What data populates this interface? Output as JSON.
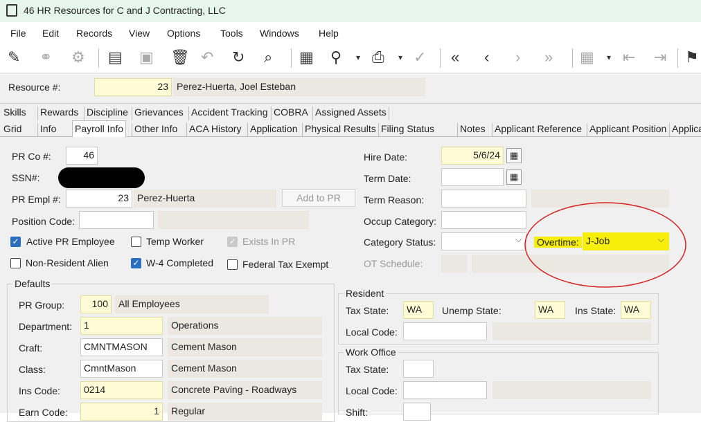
{
  "window": {
    "title": "46 HR Resources for C and J Contracting, LLC"
  },
  "menu": [
    "File",
    "Edit",
    "Records",
    "View",
    "Options",
    "Tools",
    "Windows",
    "Help"
  ],
  "header": {
    "resource_label": "Resource #:",
    "resource_num": "23",
    "resource_name": "Perez-Huerta, Joel Esteban"
  },
  "tabs_row1": [
    "Skills",
    "Rewards",
    "Discipline",
    "Grievances",
    "Accident Tracking",
    "COBRA",
    "Assigned Assets"
  ],
  "tabs_row2": [
    "Grid",
    "Info",
    "Payroll Info",
    "Other Info",
    "ACA History",
    "Application",
    "Physical Results",
    "Filing Status",
    "Notes",
    "Applicant Reference",
    "Applicant Position",
    "Applica"
  ],
  "form": {
    "prco_label": "PR Co #:",
    "prco": "46",
    "ssn_label": "SSN#:",
    "prempl_label": "PR Empl #:",
    "prempl": "23",
    "prempl_name": "Perez-Huerta",
    "addpr": "Add to PR",
    "poscode_label": "Position Code:",
    "active_pr": "Active PR Employee",
    "temp_worker": "Temp Worker",
    "exists_pr": "Exists In PR",
    "nonres": "Non-Resident Alien",
    "w4": "W-4 Completed",
    "fedexempt": "Federal Tax Exempt",
    "hire_label": "Hire Date:",
    "hire": "5/6/24",
    "term_label": "Term Date:",
    "termreason_label": "Term Reason:",
    "occup_label": "Occup Category:",
    "catstatus_label": "Category Status:",
    "overtime_label": "Overtime:",
    "overtime": "J-Job",
    "otsched_label": "OT Schedule:"
  },
  "defaults": {
    "title": "Defaults",
    "prgroup_label": "PR Group:",
    "prgroup": "100",
    "prgroup_name": "All Employees",
    "dept_label": "Department:",
    "dept": "1",
    "dept_name": "Operations",
    "craft_label": "Craft:",
    "craft": "CMNTMASON",
    "craft_name": "Cement Mason",
    "class_label": "Class:",
    "class": "CmntMason",
    "class_name": "Cement Mason",
    "ins_label": "Ins Code:",
    "ins": "0214",
    "ins_name": "Concrete Paving - Roadways",
    "earn_label": "Earn Code:",
    "earn": "1",
    "earn_name": "Regular"
  },
  "resident": {
    "title": "Resident",
    "taxstate_label": "Tax State:",
    "taxstate": "WA",
    "unemp_label": "Unemp State:",
    "unemp": "WA",
    "insstate_label": "Ins State:",
    "insstate": "WA",
    "local_label": "Local Code:"
  },
  "workoffice": {
    "title": "Work Office",
    "taxstate_label": "Tax State:",
    "local_label": "Local Code:",
    "shift_label": "Shift:"
  },
  "colors": {
    "highlight": "#f7ee0a",
    "annotation": "#d42020",
    "required": "#fffbd4"
  }
}
